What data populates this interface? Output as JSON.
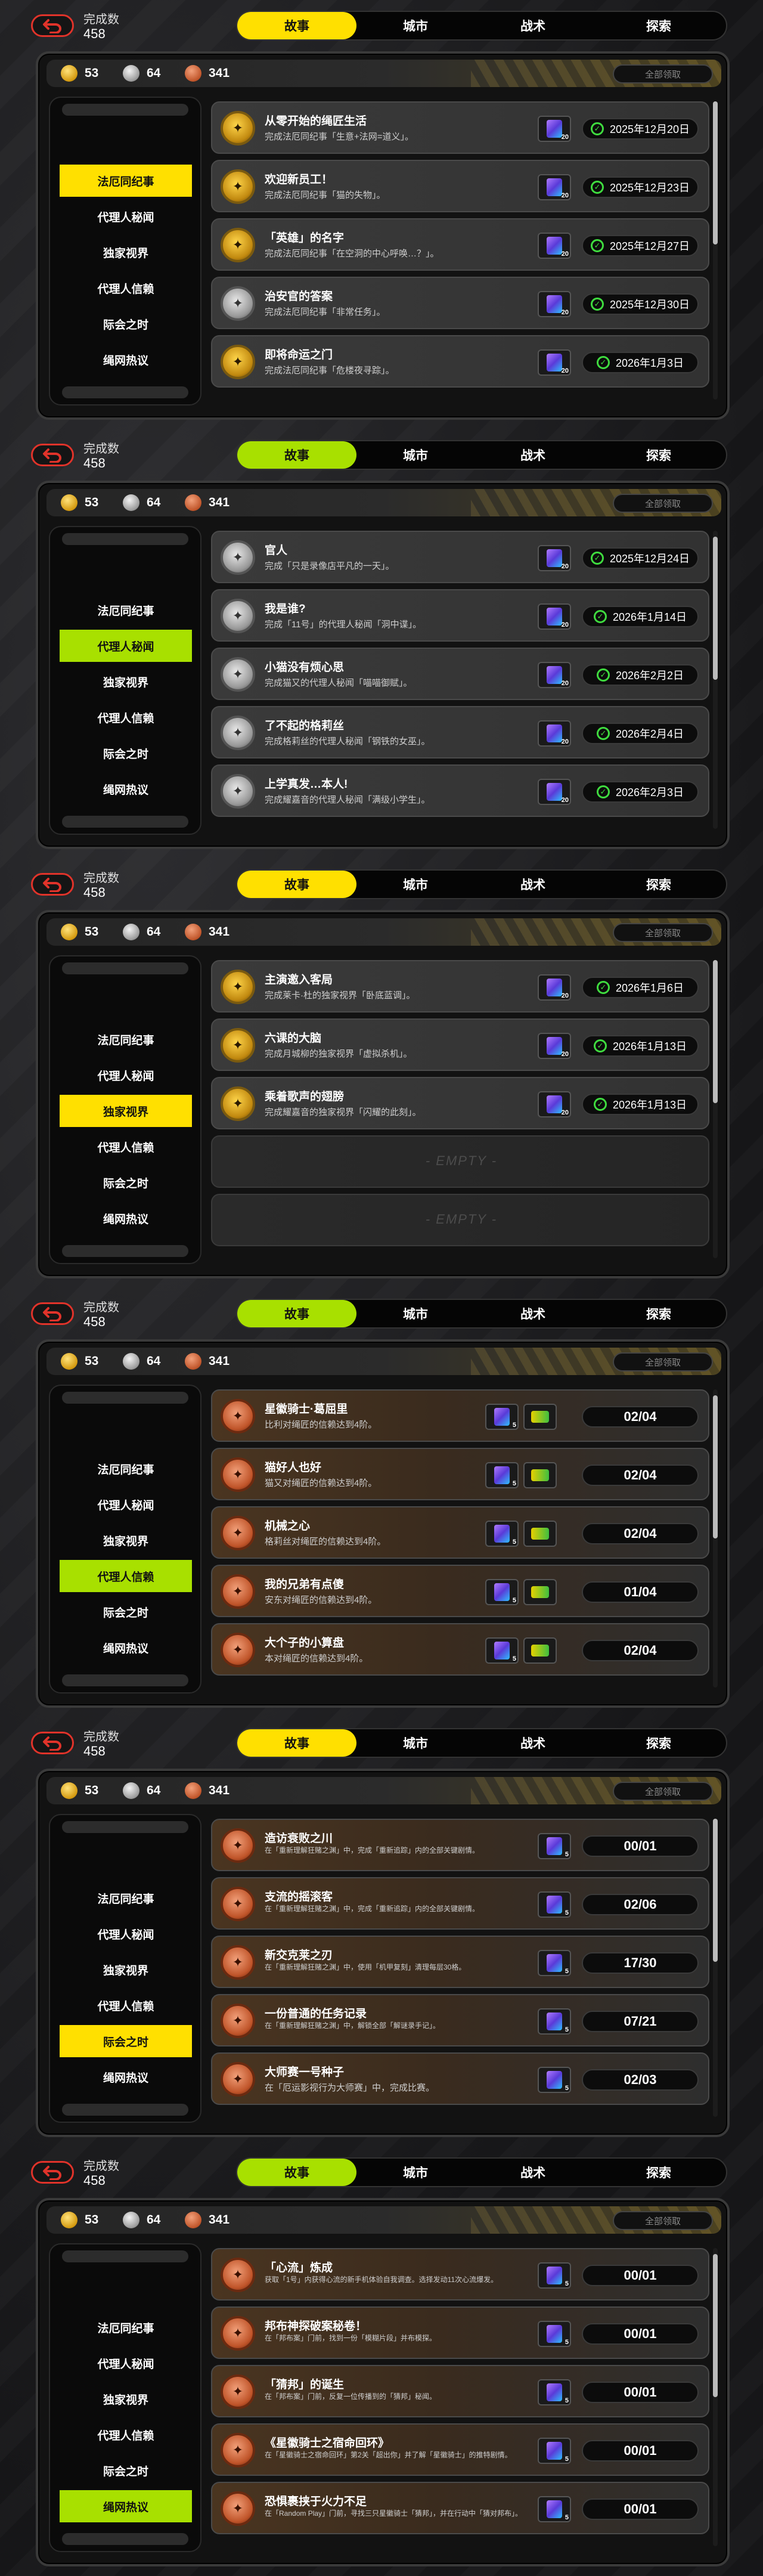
{
  "count_label": "完成数",
  "count_value": "458",
  "tabs": [
    "故事",
    "城市",
    "战术",
    "探索"
  ],
  "currency": {
    "gold": "53",
    "silver": "64",
    "bronze": "341"
  },
  "claim_all": "全部领取",
  "sidebar": [
    "法厄同纪事",
    "代理人秘闻",
    "独家视界",
    "代理人信赖",
    "际会之时",
    "绳网热议"
  ],
  "empty_label": "- EMPTY -",
  "colors": {
    "yellow": "#ffe000",
    "green": "#a8e000",
    "check": "#3fdc3f"
  },
  "screens": [
    {
      "accent": "yellow",
      "active_sidebar": 0,
      "medal": "gold",
      "rows": [
        {
          "title": "从零开始的绳匠生活",
          "desc": "完成法厄同纪事「生意+法网=道义」。",
          "reward_qty": "20",
          "status": "2025年12月20日",
          "done": true,
          "medal": "gold"
        },
        {
          "title": "欢迎新员工！",
          "desc": "完成法厄同纪事「猫的失物」。",
          "reward_qty": "20",
          "status": "2025年12月23日",
          "done": true,
          "medal": "gold"
        },
        {
          "title": "「英雄」的名字",
          "desc": "完成法厄同纪事「在空洞的中心呼唤…？」。",
          "reward_qty": "20",
          "status": "2025年12月27日",
          "done": true,
          "medal": "gold"
        },
        {
          "title": "治安官的答案",
          "desc": "完成法厄同纪事「非常任务」。",
          "reward_qty": "20",
          "status": "2025年12月30日",
          "done": true,
          "medal": "silver"
        },
        {
          "title": "即将命运之门",
          "desc": "完成法厄同纪事「危楼夜寻踪」。",
          "reward_qty": "20",
          "status": "2026年1月3日",
          "done": true,
          "medal": "gold"
        }
      ]
    },
    {
      "accent": "green",
      "active_sidebar": 1,
      "medal": "silver",
      "rows": [
        {
          "title": "官人",
          "desc": "完成「只是录像店平凡的一天」。",
          "reward_qty": "20",
          "status": "2025年12月24日",
          "done": true,
          "medal": "silver"
        },
        {
          "title": "我是谁?",
          "desc": "完成「11号」的代理人秘闻「洞中谍」。",
          "reward_qty": "20",
          "status": "2026年1月14日",
          "done": true,
          "medal": "silver"
        },
        {
          "title": "小猫没有烦心思",
          "desc": "完成猫又的代理人秘闻「喵喵御赋」。",
          "reward_qty": "20",
          "status": "2026年2月2日",
          "done": true,
          "medal": "silver"
        },
        {
          "title": "了不起的格莉丝",
          "desc": "完成格莉丝的代理人秘闻「钢铁的女巫」。",
          "reward_qty": "20",
          "status": "2026年2月4日",
          "done": true,
          "medal": "silver"
        },
        {
          "title": "上学真发…本人!",
          "desc": "完成耀嘉音的代理人秘闻「满级小学生」。",
          "reward_qty": "20",
          "status": "2026年2月3日",
          "done": true,
          "medal": "silver"
        }
      ]
    },
    {
      "accent": "yellow",
      "active_sidebar": 2,
      "medal": "gold",
      "rows": [
        {
          "title": "主演邀入客局",
          "desc": "完成莱卡·杜的独家视界「卧底蓝调」。",
          "reward_qty": "20",
          "status": "2026年1月6日",
          "done": true,
          "medal": "gold"
        },
        {
          "title": "六课的大脑",
          "desc": "完成月城柳的独家视界「虚拟杀机」。",
          "reward_qty": "20",
          "status": "2026年1月13日",
          "done": true,
          "medal": "gold"
        },
        {
          "title": "乘着歌声的翅膀",
          "desc": "完成耀嘉音的独家视界「闪耀的此刻」。",
          "reward_qty": "20",
          "status": "2026年1月13日",
          "done": true,
          "medal": "gold"
        },
        {
          "empty": true
        },
        {
          "empty": true
        }
      ]
    },
    {
      "accent": "green",
      "active_sidebar": 3,
      "medal": "bronze",
      "rows": [
        {
          "title": "星徽骑士·葛屈里",
          "desc": "比利对绳匠的信赖达到4阶。",
          "reward_qty": "5",
          "status": "02/04",
          "double": true,
          "medal": "bronze"
        },
        {
          "title": "猫好人也好",
          "desc": "猫又对绳匠的信赖达到4阶。",
          "reward_qty": "5",
          "status": "02/04",
          "double": true,
          "medal": "bronze"
        },
        {
          "title": "机械之心",
          "desc": "格莉丝对绳匠的信赖达到4阶。",
          "reward_qty": "5",
          "status": "02/04",
          "double": true,
          "medal": "bronze"
        },
        {
          "title": "我的兄弟有点傻",
          "desc": "安东对绳匠的信赖达到4阶。",
          "reward_qty": "5",
          "status": "01/04",
          "double": true,
          "medal": "bronze"
        },
        {
          "title": "大个子的小算盘",
          "desc": "本对绳匠的信赖达到4阶。",
          "reward_qty": "5",
          "status": "02/04",
          "double": true,
          "medal": "bronze"
        }
      ]
    },
    {
      "accent": "yellow",
      "active_sidebar": 4,
      "medal": "bronze",
      "rows": [
        {
          "title": "造访衰败之川",
          "desc": "在「重新理解狂赌之渊」中，完成「重新追踪」内的全部关键剧情。",
          "reward_qty": "5",
          "status": "00/01",
          "small": true,
          "medal": "bronze"
        },
        {
          "title": "支流的摇滚客",
          "desc": "在「重新理解狂赌之渊」中，完成「重新追踪」内的全部关键剧情。",
          "reward_qty": "5",
          "status": "02/06",
          "small": true,
          "medal": "bronze"
        },
        {
          "title": "新交克莱之刃",
          "desc": "在「重新理解狂赌之渊」中，使用「机甲复刻」清理每层30格。",
          "reward_qty": "5",
          "status": "17/30",
          "small": true,
          "medal": "bronze"
        },
        {
          "title": "一份普通的任务记录",
          "desc": "在「重新理解狂赌之渊」中，解锁全部「解谜录手记」。",
          "reward_qty": "5",
          "status": "07/21",
          "small": true,
          "medal": "bronze"
        },
        {
          "title": "大师赛一号种子",
          "desc": "在「厄运影视行为大师赛」中，完成比赛。",
          "reward_qty": "5",
          "status": "02/03",
          "small": false,
          "medal": "bronze"
        }
      ]
    },
    {
      "accent": "green",
      "active_sidebar": 5,
      "medal": "bronze",
      "rows": [
        {
          "title": "「心流」炼成",
          "desc": "获取「1号」内获得心流的新手机体验自我调查。选择发动11次心流爆发。",
          "reward_qty": "5",
          "status": "00/01",
          "small": true,
          "medal": "bronze"
        },
        {
          "title": "邦布神探破案秘卷！",
          "desc": "在「邦布案」门前，找到一份「模糊片段」并布模探。",
          "reward_qty": "5",
          "status": "00/01",
          "small": true,
          "medal": "bronze"
        },
        {
          "title": "「猜邦」的诞生",
          "desc": "在「邦布案」门前，反复一位传播到的「猜邦」秘闻。",
          "reward_qty": "5",
          "status": "00/01",
          "small": true,
          "medal": "bronze"
        },
        {
          "title": "《星徽骑士之宿命回环》",
          "desc": "在「星徽骑士之宿命回环」第2关「超出你」并了解「星徽骑士」的推特剧情。",
          "reward_qty": "5",
          "status": "00/01",
          "small": true,
          "medal": "bronze"
        },
        {
          "title": "恐惧裹挟于火力不足",
          "desc": "在「Random Play」门前，寻找三只星徽骑士「猜邦」，并在行动中「猜对邦布」。",
          "reward_qty": "5",
          "status": "00/01",
          "small": true,
          "medal": "bronze"
        }
      ]
    }
  ]
}
